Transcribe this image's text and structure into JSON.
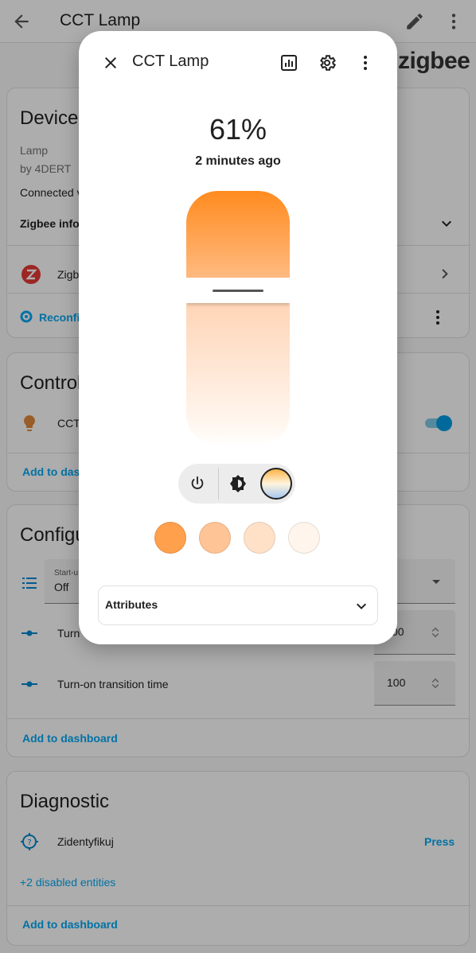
{
  "topbar": {
    "title": "CCT Lamp"
  },
  "brand_logo": "zigbee",
  "device_card": {
    "title": "Device",
    "model": "Lamp",
    "manufacturer": "by 4DERT",
    "connected": "Connected v",
    "zigbee_info": "Zigbee info",
    "integration": "Zigb",
    "reconfigure": "Reconfig"
  },
  "controls_card": {
    "title": "Control",
    "entity": "CCT",
    "add_to_dashboard": "Add to dash",
    "switch_on": true
  },
  "config_card": {
    "title": "Configu",
    "startup_label": "Start-u",
    "startup_value": "Off",
    "turn_off_label": "Turn",
    "turn_off_value": "00",
    "turn_on_label": "Turn-on transition time",
    "turn_on_value": "100",
    "add_to_dashboard": "Add to dashboard"
  },
  "diagnostic_card": {
    "title": "Diagnostic",
    "identify_label": "Zidentyfikuj",
    "identify_action": "Press",
    "disabled_entities": "+2 disabled entities",
    "add_to_dashboard": "Add to dashboard"
  },
  "dialog": {
    "title": "CCT Lamp",
    "brightness_display": "61%",
    "brightness_fraction": 0.61,
    "last_changed": "2 minutes ago",
    "attributes_label": "Attributes",
    "favorite_colors": [
      "#ffa04d",
      "#ffc496",
      "#ffe1c8",
      "#fff5ec"
    ],
    "slider_colors": {
      "top": "#ff8b1f",
      "bottom": "#fff7f0"
    }
  }
}
